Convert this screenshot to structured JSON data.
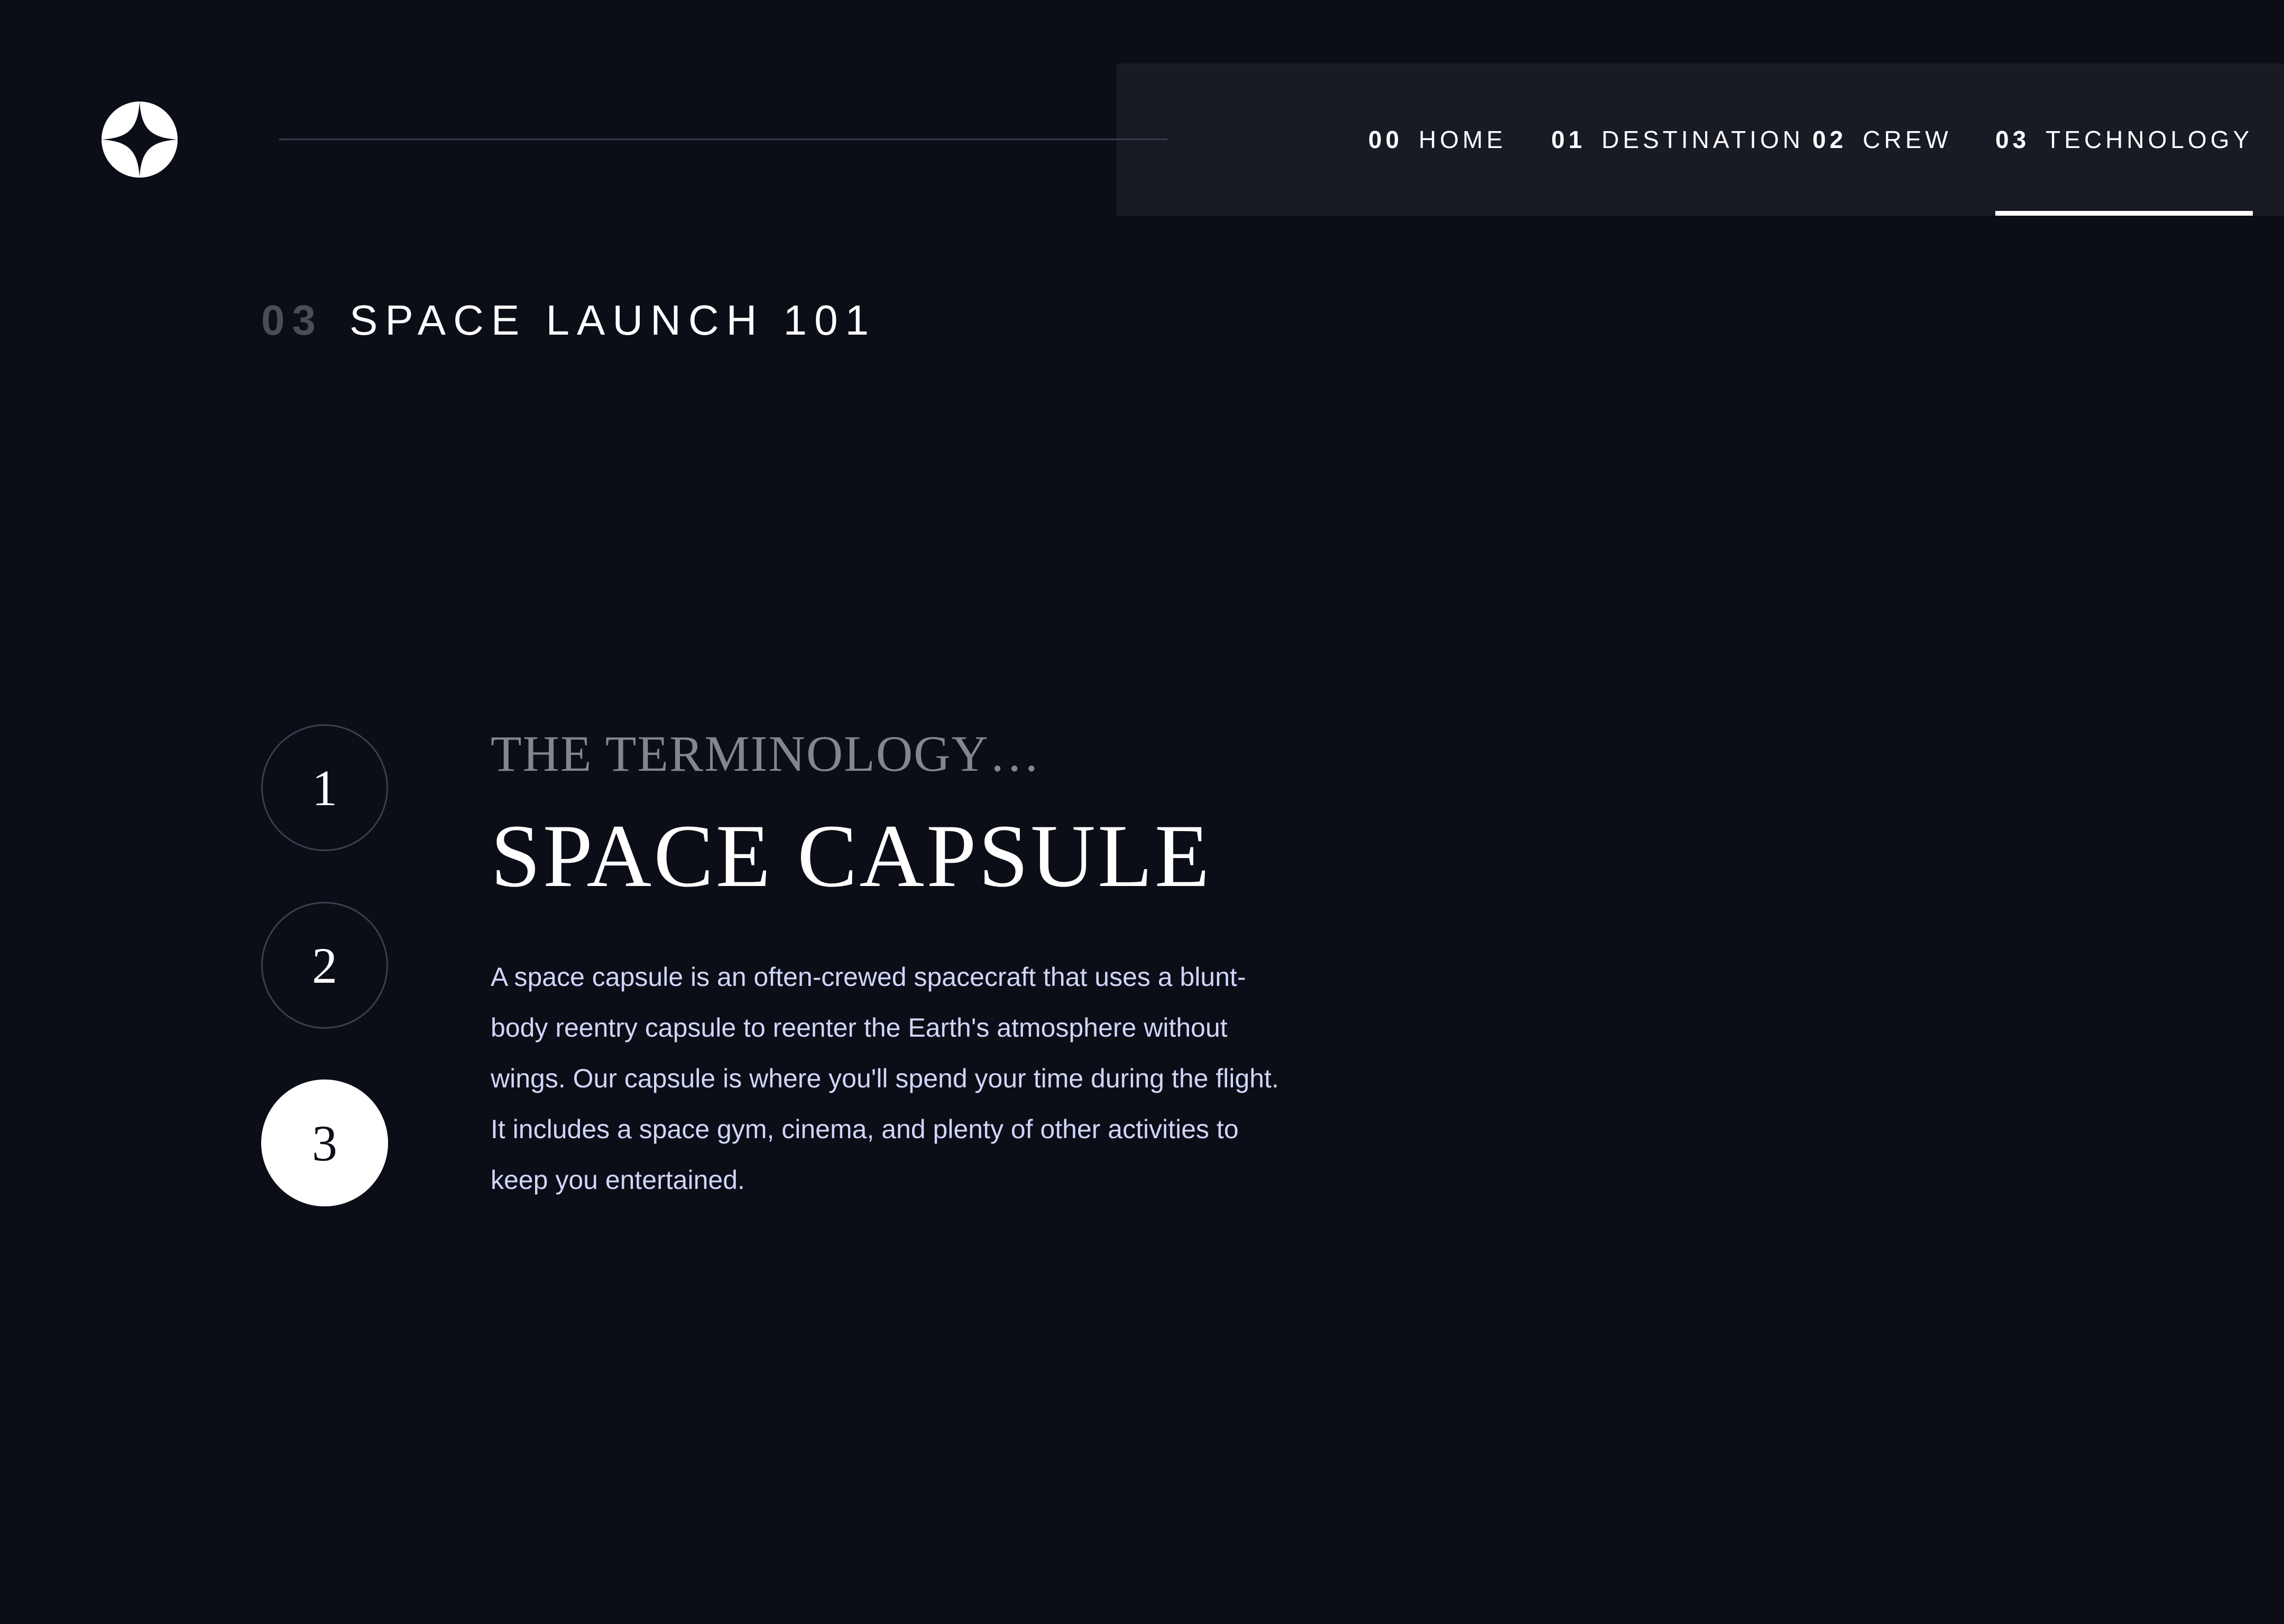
{
  "header": {
    "logo_icon": "star-logo-icon"
  },
  "nav": {
    "items": [
      {
        "num": "00",
        "label": "HOME"
      },
      {
        "num": "01",
        "label": "DESTINATION"
      },
      {
        "num": "02",
        "label": "CREW"
      },
      {
        "num": "03",
        "label": "TECHNOLOGY",
        "active": true
      }
    ]
  },
  "page": {
    "number": "03",
    "title": "SPACE LAUNCH 101"
  },
  "steps": {
    "items": [
      "1",
      "2",
      "3"
    ],
    "active_index": 2
  },
  "technology": {
    "label": "THE TERMINOLOGY…",
    "name": "SPACE CAPSULE",
    "description": "A space capsule is an often-crewed spacecraft that uses a blunt-body reentry capsule to reenter the Earth's atmosphere without wings. Our capsule is where you'll spend your time during the flight. It includes a space gym, cinema, and plenty of other activities to keep you entertained."
  },
  "colors": {
    "background": "#0b0d17",
    "nav_background": "#181a24",
    "accent_text": "#d0d6f9",
    "white": "#ffffff"
  }
}
